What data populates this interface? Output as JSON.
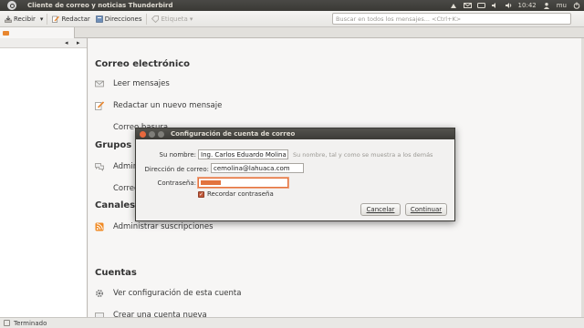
{
  "top_panel": {
    "title": "Cliente de correo y noticias Thunderbird",
    "clock": "10:42",
    "user": "mu"
  },
  "toolbar": {
    "get_mail": "Recibir",
    "write": "Redactar",
    "address_book": "Direcciones",
    "tag": "Etiqueta",
    "search_placeholder": "Buscar en todos los mensajes... <Ctrl+K>"
  },
  "main": {
    "sections": [
      {
        "title": "Correo electrónico",
        "items": [
          "Leer mensajes",
          "Redactar un nuevo mensaje",
          "Correo basura"
        ]
      },
      {
        "title": "Grupos de noticias",
        "items": [
          "Administrar suscripciones",
          "Correo"
        ]
      },
      {
        "title": "Canales",
        "items": [
          "Administrar suscripciones"
        ]
      },
      {
        "title": "Cuentas",
        "items": [
          "Ver configuración de esta cuenta",
          "Crear una cuenta nueva"
        ]
      }
    ]
  },
  "dialog": {
    "title": "Configuración de cuenta de correo",
    "name_label": "Su nombre:",
    "name_value": "Ing. Carlos Eduardo Molina C.",
    "name_hint": "Su nombre, tal y como se muestra a los demás",
    "email_label": "Dirección de correo:",
    "email_value": "cemolina@lahuaca.com",
    "password_label": "Contraseña:",
    "remember_label": "Recordar contraseña",
    "remember_checked": true,
    "cancel": "Cancelar",
    "continue": "Continuar"
  },
  "status": {
    "text": "Terminado"
  },
  "colors": {
    "accent": "#e2733f",
    "panel": "#3c3b37"
  }
}
